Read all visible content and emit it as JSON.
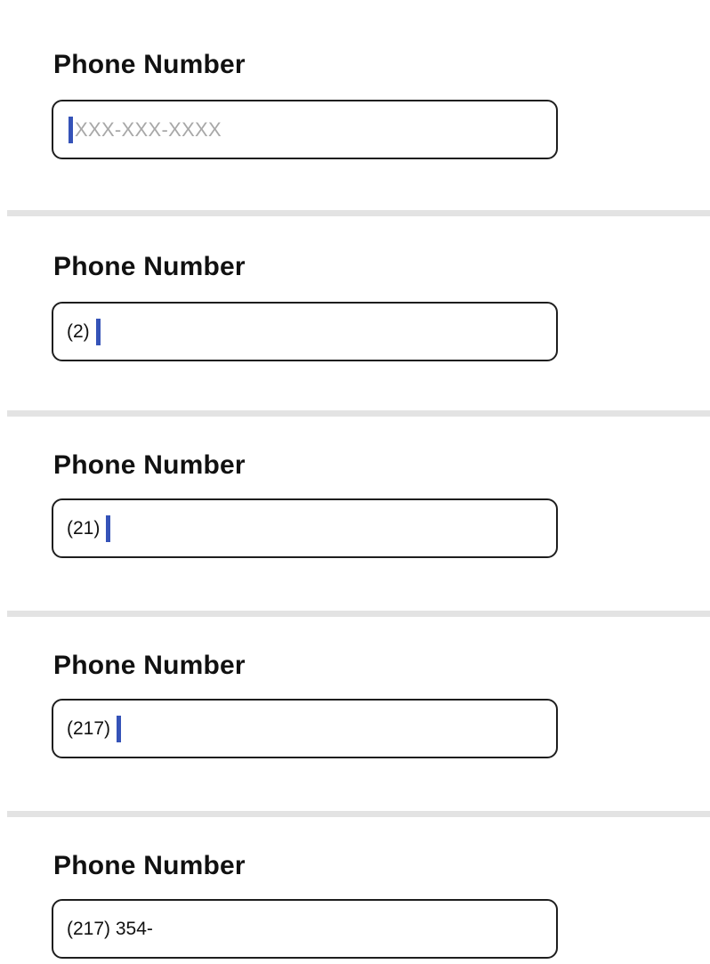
{
  "fields": [
    {
      "label": "Phone Number",
      "value": "",
      "placeholder": "XXX-XXX-XXXX"
    },
    {
      "label": "Phone Number",
      "value": "(2)",
      "placeholder": ""
    },
    {
      "label": "Phone Number",
      "value": "(21)",
      "placeholder": ""
    },
    {
      "label": "Phone Number",
      "value": "(217)",
      "placeholder": ""
    },
    {
      "label": "Phone Number",
      "value": "(217) 354-",
      "placeholder": ""
    }
  ],
  "colors": {
    "caret": "#3553b8",
    "divider": "#e3e3e3",
    "border": "#1e1e1e",
    "placeholder": "#a8a8a8"
  }
}
